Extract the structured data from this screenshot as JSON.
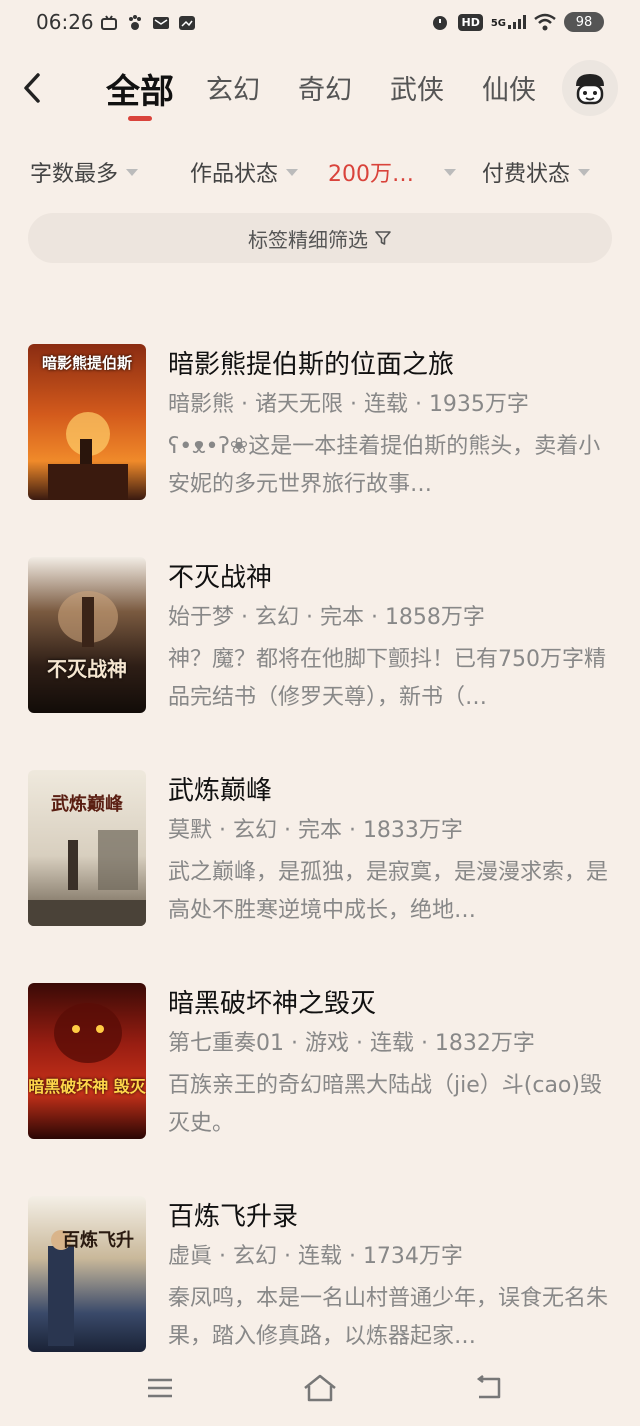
{
  "status_bar": {
    "time": "06:26",
    "network": "5G",
    "hd_label": "HD",
    "battery": "98"
  },
  "tabs": [
    {
      "label": "全部",
      "active": true
    },
    {
      "label": "玄幻"
    },
    {
      "label": "奇幻"
    },
    {
      "label": "武侠"
    },
    {
      "label": "仙侠"
    }
  ],
  "filters": [
    {
      "label": "字数最多"
    },
    {
      "label": "作品状态"
    },
    {
      "label": "200万…",
      "active": true
    },
    {
      "label": "付费状态"
    }
  ],
  "tag_filter": {
    "label": "标签精细筛选"
  },
  "books": [
    {
      "title": "暗影熊提伯斯的位面之旅",
      "meta": "暗影熊 · 诸天无限 · 连载 · 1935万字",
      "desc": "ʕ•ᴥ•ʔ❀这是一本挂着提伯斯的熊头，卖着小安妮的多元世界旅行故事…",
      "cover_text": "暗影熊提伯斯",
      "cover_color": "#c4501e"
    },
    {
      "title": "不灭战神",
      "meta": "始于梦 · 玄幻 · 完本 · 1858万字",
      "desc": "神？魔？都将在他脚下颤抖！已有750万字精品完结书（修罗天尊），新书（…",
      "cover_text": "不灭战神",
      "cover_color": "#3b2a20"
    },
    {
      "title": "武炼巅峰",
      "meta": "莫默 · 玄幻 · 完本 · 1833万字",
      "desc": "武之巅峰，是孤独，是寂寞，是漫漫求索，是高处不胜寒逆境中成长，绝地…",
      "cover_text": "武炼巅峰",
      "cover_color": "#d9d2c4"
    },
    {
      "title": "暗黑破坏神之毁灭",
      "meta": "第七重奏01 · 游戏 · 连载 · 1832万字",
      "desc": "百族亲王的奇幻暗黑大陆战（jie）斗(cao)毁灭史。",
      "cover_text": "暗黑破坏神 毁灭",
      "cover_color": "#8a1a12"
    },
    {
      "title": "百炼飞升录",
      "meta": "虚眞 · 玄幻 · 连载 · 1734万字",
      "desc": "秦凤鸣，本是一名山村普通少年，误食无名朱果，踏入修真路，以炼器起家…",
      "cover_text": "百炼飞升",
      "cover_color": "#2d3a5a"
    }
  ]
}
